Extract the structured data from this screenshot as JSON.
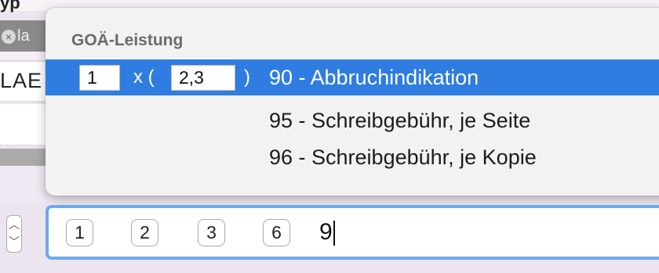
{
  "background": {
    "top_fragment": "yp",
    "tag_fragment": "la",
    "row_fragment": "LAE"
  },
  "popup": {
    "title": "GOÄ-Leistung",
    "selected_quantity": "1",
    "multiplier_prefix": "x (",
    "factor": "2,3",
    "multiplier_suffix": ")",
    "items": [
      {
        "label": "90 - Abbruchindikation",
        "selected": true
      },
      {
        "label": "95 - Schreibgebühr, je Seite",
        "selected": false
      },
      {
        "label": "96 - Schreibgebühr, je Kopie",
        "selected": false
      }
    ]
  },
  "input_bar": {
    "tokens": [
      "1",
      "2",
      "3",
      "6"
    ],
    "typed_text": "9"
  },
  "colors": {
    "selection": "#2f7de0",
    "focus_ring": "#6ea9ee"
  }
}
